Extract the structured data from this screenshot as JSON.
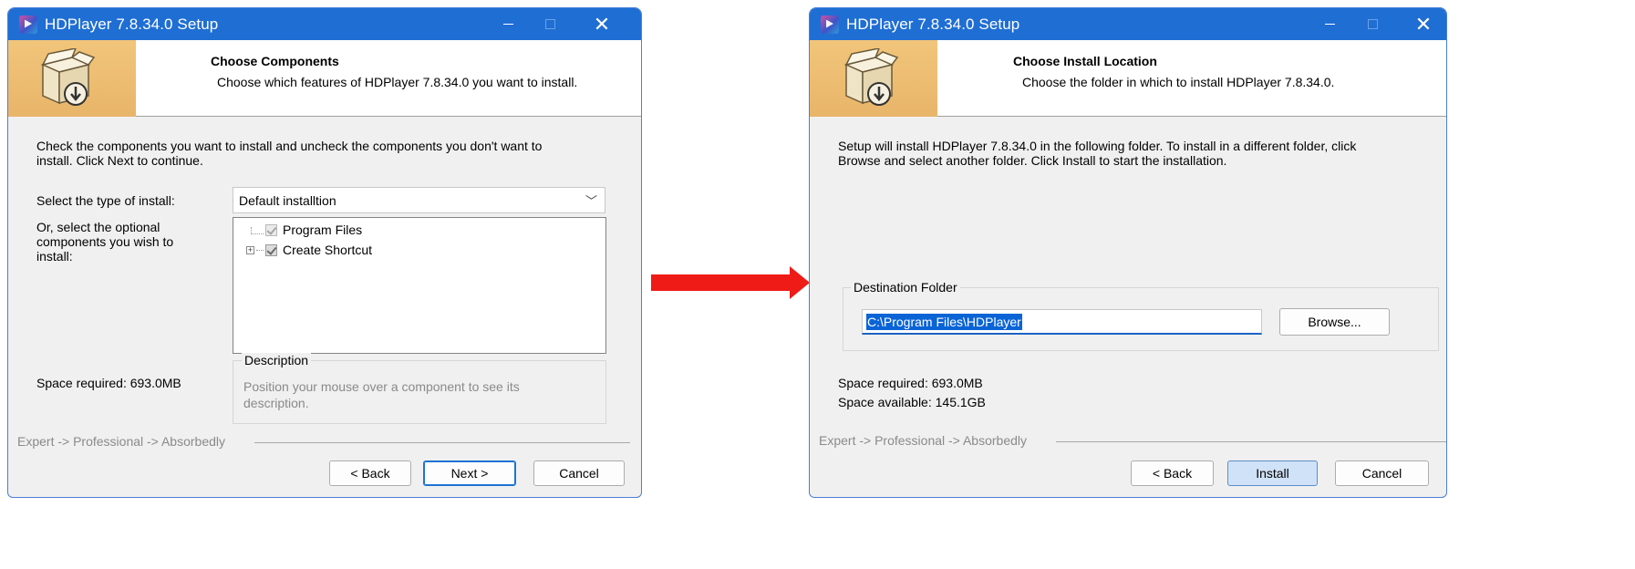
{
  "colors": {
    "titlebar": "#1f6ed4",
    "arrow": "#ee1b16",
    "accent": "#1e73d3",
    "header_band": "#f1c57a"
  },
  "left_window": {
    "title": "HDPlayer 7.8.34.0 Setup",
    "header_title": "Choose Components",
    "header_subtitle": "Choose which features of HDPlayer 7.8.34.0 you want to install.",
    "instruction_line1": "Check the components you want to install and uncheck the components you don't want to",
    "instruction_line2": "install. Click Next to continue.",
    "install_type_label": "Select the type of install:",
    "install_type_value": "Default installtion",
    "optional_label_line1": "Or, select the optional",
    "optional_label_line2": "components you wish to",
    "optional_label_line3": "install:",
    "components": [
      "Program Files",
      "Create Shortcut"
    ],
    "space_required": "Space required: 693.0MB",
    "description_title": "Description",
    "description_line1": "Position your mouse over a component to see its",
    "description_line2": "description.",
    "branding": "Expert -> Professional -> Absorbedly",
    "back_label": "< Back",
    "next_label": "Next >",
    "cancel_label": "Cancel"
  },
  "right_window": {
    "title": "HDPlayer 7.8.34.0 Setup",
    "header_title": "Choose Install Location",
    "header_subtitle": "Choose the folder in which to install HDPlayer 7.8.34.0.",
    "instruction_line1": "Setup will install HDPlayer 7.8.34.0 in the following folder. To install in a different folder, click",
    "instruction_line2": "Browse and select another folder. Click Install to start the installation.",
    "destination_title": "Destination Folder",
    "destination_path": "C:\\Program Files\\HDPlayer",
    "browse_label": "Browse...",
    "space_required": "Space required: 693.0MB",
    "space_available": "Space available: 145.1GB",
    "branding": "Expert -> Professional -> Absorbedly",
    "back_label": "< Back",
    "install_label": "Install",
    "cancel_label": "Cancel"
  }
}
